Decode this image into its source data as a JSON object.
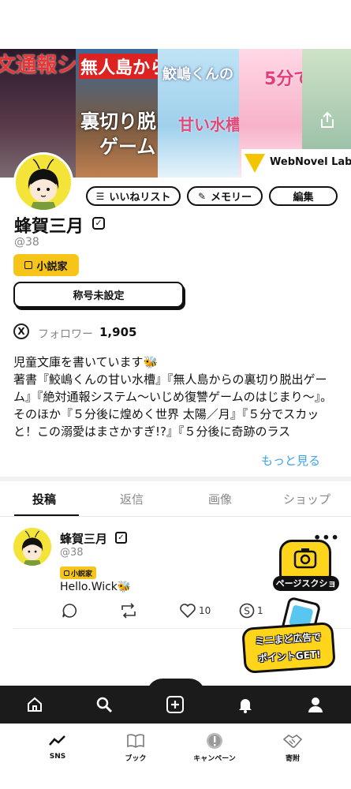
{
  "banner": {
    "covers": [
      {
        "title": "文通報システム"
      },
      {
        "title_top": "無人島からの",
        "title_mid": "裏切り脱出",
        "title_bottom": "ゲーム"
      },
      {
        "title_top": "鮫嶋くんの",
        "title_bottom": "甘い水槽"
      },
      {
        "title": "5分で"
      },
      {
        "title": ""
      }
    ],
    "brand": "WebNovel Labo",
    "share_icon": "share-icon"
  },
  "profile": {
    "like_list_label": "いいねリスト",
    "memory_label": "メモリー",
    "edit_label": "編集",
    "display_name": "蜂賀三月",
    "verified_mark": "✓",
    "handle": "@38",
    "badge": "小説家",
    "title_button": "称号未設定",
    "x_icon": "X",
    "follower_label": "フォロワー",
    "follower_count": "1,905",
    "bio": "児童文庫を書いています🐝\n著書『鮫嶋くんの甘い水槽』『無人島からの裏切り脱出ゲーム』『絶対通報システム〜いじめ復讐ゲームのはじまり〜』。そのほか『５分後に煌めく世界 太陽／月』『５分でスカッと！この溺愛はまさかすぎ!?』『５分後に奇跡のラス",
    "more_link": "もっと見る"
  },
  "tabs": [
    "投稿",
    "返信",
    "画像",
    "ショップ"
  ],
  "post": {
    "author": "蜂賀三月",
    "verified_mark": "✓",
    "handle": "@38",
    "badge": "小説家",
    "menu": "•••",
    "text": "Hello.Wick🐝",
    "likes": "10",
    "super_count": "1"
  },
  "floating": {
    "screenshot_label": "ページスクショ",
    "ad_line1": "ミニまど広告で",
    "ad_line2": "ポイントGET!"
  },
  "bottom_nav": [
    {
      "label": "SNS",
      "icon": "trend-icon"
    },
    {
      "label": "ブック",
      "icon": "book-icon"
    },
    {
      "label": "キャンペーン",
      "icon": "campaign-icon"
    },
    {
      "label": "寄附",
      "icon": "handshake-icon"
    }
  ]
}
